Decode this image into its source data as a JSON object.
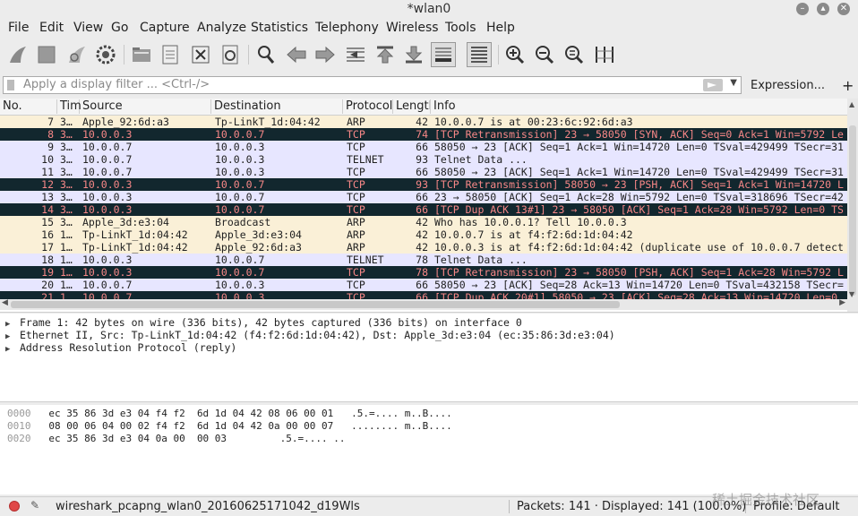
{
  "window": {
    "title": "*wlan0"
  },
  "menu": [
    "File",
    "Edit",
    "View",
    "Go",
    "Capture",
    "Analyze",
    "Statistics",
    "Telephony",
    "Wireless",
    "Tools",
    "Help"
  ],
  "toolbar": {
    "icons": [
      "shark-fin-start-icon",
      "stop-capture-icon",
      "restart-capture-icon",
      "capture-options-icon",
      "open-file-icon",
      "save-file-icon",
      "close-file-icon",
      "reload-file-icon",
      "find-packet-icon",
      "go-back-icon",
      "go-forward-icon",
      "go-to-packet-icon",
      "first-packet-icon",
      "last-packet-icon",
      "auto-scroll-icon",
      "colorize-icon",
      "zoom-in-icon",
      "zoom-out-icon",
      "zoom-normal-icon",
      "resize-columns-icon"
    ]
  },
  "filter": {
    "placeholder": "Apply a display filter ... <Ctrl-/>",
    "expression_label": "Expression...",
    "add_label": "+"
  },
  "packet_list": {
    "columns": [
      "No.",
      "Tim",
      "Source",
      "Destination",
      "Protocol",
      "Length",
      "Info"
    ],
    "rows": [
      {
        "no": "7",
        "time": "3…",
        "src": "Apple_92:6d:a3",
        "dst": "Tp-LinkT_1d:04:42",
        "proto": "ARP",
        "len": "42",
        "info": "10.0.0.7 is at 00:23:6c:92:6d:a3",
        "style": "arp"
      },
      {
        "no": "8",
        "time": "3…",
        "src": "10.0.0.3",
        "dst": "10.0.0.7",
        "proto": "TCP",
        "len": "74",
        "info": "[TCP Retransmission] 23 → 58050 [SYN, ACK] Seq=0 Ack=1 Win=5792 Le",
        "style": "bad"
      },
      {
        "no": "9",
        "time": "3…",
        "src": "10.0.0.7",
        "dst": "10.0.0.3",
        "proto": "TCP",
        "len": "66",
        "info": "58050 → 23 [ACK] Seq=1 Ack=1 Win=14720 Len=0 TSval=429499 TSecr=31",
        "style": "tcp"
      },
      {
        "no": "10",
        "time": "3…",
        "src": "10.0.0.7",
        "dst": "10.0.0.3",
        "proto": "TELNET",
        "len": "93",
        "info": "Telnet Data ...",
        "style": "tcp"
      },
      {
        "no": "11",
        "time": "3…",
        "src": "10.0.0.7",
        "dst": "10.0.0.3",
        "proto": "TCP",
        "len": "66",
        "info": "58050 → 23 [ACK] Seq=1 Ack=1 Win=14720 Len=0 TSval=429499 TSecr=31",
        "style": "tcp"
      },
      {
        "no": "12",
        "time": "3…",
        "src": "10.0.0.3",
        "dst": "10.0.0.7",
        "proto": "TCP",
        "len": "93",
        "info": "[TCP Retransmission] 58050 → 23 [PSH, ACK] Seq=1 Ack=1 Win=14720 L",
        "style": "bad"
      },
      {
        "no": "13",
        "time": "3…",
        "src": "10.0.0.3",
        "dst": "10.0.0.7",
        "proto": "TCP",
        "len": "66",
        "info": "23 → 58050 [ACK] Seq=1 Ack=28 Win=5792 Len=0 TSval=318696 TSecr=42",
        "style": "tcp"
      },
      {
        "no": "14",
        "time": "3…",
        "src": "10.0.0.3",
        "dst": "10.0.0.7",
        "proto": "TCP",
        "len": "66",
        "info": "[TCP Dup ACK 13#1] 23 → 58050 [ACK] Seq=1 Ack=28 Win=5792 Len=0 TS",
        "style": "bad"
      },
      {
        "no": "15",
        "time": "3…",
        "src": "Apple_3d:e3:04",
        "dst": "Broadcast",
        "proto": "ARP",
        "len": "42",
        "info": "Who has 10.0.0.1? Tell 10.0.0.3",
        "style": "arp"
      },
      {
        "no": "16",
        "time": "1…",
        "src": "Tp-LinkT_1d:04:42",
        "dst": "Apple_3d:e3:04",
        "proto": "ARP",
        "len": "42",
        "info": "10.0.0.7 is at f4:f2:6d:1d:04:42",
        "style": "arp"
      },
      {
        "no": "17",
        "time": "1…",
        "src": "Tp-LinkT_1d:04:42",
        "dst": "Apple_92:6d:a3",
        "proto": "ARP",
        "len": "42",
        "info": "10.0.0.3 is at f4:f2:6d:1d:04:42 (duplicate use of 10.0.0.7 detect",
        "style": "arp"
      },
      {
        "no": "18",
        "time": "1…",
        "src": "10.0.0.3",
        "dst": "10.0.0.7",
        "proto": "TELNET",
        "len": "78",
        "info": "Telnet Data ...",
        "style": "tcp"
      },
      {
        "no": "19",
        "time": "1…",
        "src": "10.0.0.3",
        "dst": "10.0.0.7",
        "proto": "TCP",
        "len": "78",
        "info": "[TCP Retransmission] 23 → 58050 [PSH, ACK] Seq=1 Ack=28 Win=5792 L",
        "style": "bad"
      },
      {
        "no": "20",
        "time": "1…",
        "src": "10.0.0.7",
        "dst": "10.0.0.3",
        "proto": "TCP",
        "len": "66",
        "info": "58050 → 23 [ACK] Seq=28 Ack=13 Win=14720 Len=0 TSval=432158 TSecr=",
        "style": "tcp"
      },
      {
        "no": "21",
        "time": "1…",
        "src": "10.0.0.7",
        "dst": "10.0.0.3",
        "proto": "TCP",
        "len": "66",
        "info": "[TCP Dup ACK 20#1] 58050 → 23 [ACK] Seq=28 Ack=13 Win=14720 Len=0",
        "style": "bad"
      }
    ]
  },
  "details": [
    "Frame 1: 42 bytes on wire (336 bits), 42 bytes captured (336 bits) on interface 0",
    "Ethernet II, Src: Tp-LinkT_1d:04:42 (f4:f2:6d:1d:04:42), Dst: Apple_3d:e3:04 (ec:35:86:3d:e3:04)",
    "Address Resolution Protocol (reply)"
  ],
  "bytes": [
    {
      "offset": "0000",
      "hex": "ec 35 86 3d e3 04 f4 f2  6d 1d 04 42 08 06 00 01",
      "ascii": ".5.=.... m..B...."
    },
    {
      "offset": "0010",
      "hex": "08 00 06 04 00 02 f4 f2  6d 1d 04 42 0a 00 00 07",
      "ascii": "........ m..B...."
    },
    {
      "offset": "0020",
      "hex": "ec 35 86 3d e3 04 0a 00  00 03",
      "ascii": ".5.=.... .."
    }
  ],
  "status": {
    "file": "wireshark_pcapng_wlan0_20160625171042_d19Wls",
    "packets": "Packets: 141 · Displayed: 141 (100.0%)",
    "profile": "Profile: Default"
  },
  "watermark": "稀土掘金技术社区",
  "colors": {
    "arp_row": "#faf0d7",
    "tcp_row": "#e7e6ff",
    "bad_row_bg": "#12272e",
    "bad_row_fg": "#f78787"
  }
}
